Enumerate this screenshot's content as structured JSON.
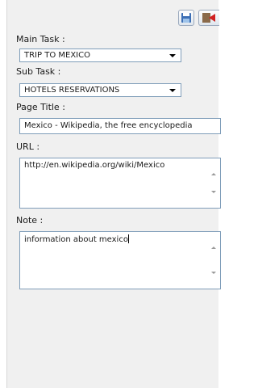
{
  "toolbar": {
    "save_icon": "floppy-disk-icon",
    "close_icon": "exit-icon"
  },
  "form": {
    "main_task_label": "Main Task :",
    "main_task_value": "TRIP TO MEXICO",
    "sub_task_label": "Sub Task :",
    "sub_task_value": "HOTELS RESERVATIONS",
    "page_title_label": "Page Title :",
    "page_title_value": "Mexico - Wikipedia, the free encyclopedia",
    "url_label": "URL :",
    "url_value": "http://en.wikipedia.org/wiki/Mexico",
    "note_label": "Note :",
    "note_value": "information about mexico"
  },
  "colors": {
    "panel_bg": "#f0f0f0",
    "field_border": "#7f9db9"
  }
}
